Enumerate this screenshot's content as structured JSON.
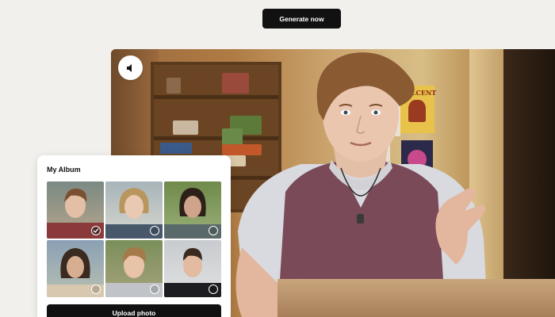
{
  "header": {
    "generate_label": "Generate now"
  },
  "video": {
    "mute_icon": "speaker-muted-icon",
    "poster_text": "DOLCENT"
  },
  "album": {
    "title": "My Album",
    "upload_label": "Upload photo",
    "photos": [
      {
        "selected": true
      },
      {
        "selected": false
      },
      {
        "selected": false
      },
      {
        "selected": false
      },
      {
        "selected": false
      },
      {
        "selected": false
      }
    ]
  },
  "colors": {
    "button_bg": "#111111",
    "page_bg": "#f2f0ec",
    "card_bg": "#ffffff"
  }
}
